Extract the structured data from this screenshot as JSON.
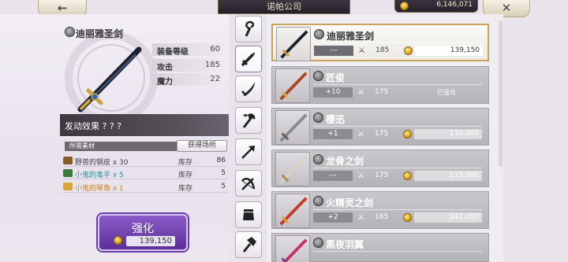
{
  "header": {
    "back_icon": "←",
    "title": "诺帕公司",
    "gold": "6,146,071",
    "close_icon": "✕"
  },
  "detail": {
    "name": "迪丽雅圣剑",
    "stats": [
      {
        "label": "装备等级",
        "value": "60"
      },
      {
        "label": "攻击",
        "value": "185"
      },
      {
        "label": "魔力",
        "value": "22"
      }
    ],
    "effect": "发动效果 ? ? ?",
    "materials_label": "所需素材",
    "source_button": "获得场所",
    "materials": [
      {
        "name": "野兽的钢皮 x 30",
        "stock_label": "库存",
        "stock": "86",
        "color": "#444444",
        "icon_color": "#8b5a2b"
      },
      {
        "name": "小鬼的毒手 x 5",
        "stock_label": "库存",
        "stock": "5",
        "color": "#2f8f9a",
        "icon_color": "#3a7a3a"
      },
      {
        "name": "小鬼的琴角 x 1",
        "stock_label": "库存",
        "stock": "5",
        "color": "#c8862a",
        "icon_color": "#d9a23a"
      }
    ],
    "enhance_label": "强化",
    "enhance_cost": "139,150"
  },
  "tabs": [
    {
      "icon": "staff-icon"
    },
    {
      "icon": "sword-icon"
    },
    {
      "icon": "curved-blade-icon"
    },
    {
      "icon": "axe-icon"
    },
    {
      "icon": "arrow-icon"
    },
    {
      "icon": "crossbow-icon"
    },
    {
      "icon": "gauntlet-icon"
    },
    {
      "icon": "hammer-icon"
    }
  ],
  "items": [
    {
      "name": "迪丽雅圣剑",
      "level": "---",
      "atk": "185",
      "price": "139,150",
      "owned": "",
      "selected": true,
      "blade": "#1c2230",
      "hilt": "#c9a43a"
    },
    {
      "name": "匠俊",
      "level": "+10",
      "atk": "175",
      "price": "",
      "owned": "已强化",
      "selected": false,
      "blade": "#a8452a",
      "hilt": "#d9b45a"
    },
    {
      "name": "樱迅",
      "level": "+1",
      "atk": "175",
      "price": "110,000",
      "owned": "",
      "selected": false,
      "blade": "#8a8a8e",
      "hilt": "#6a5a4a"
    },
    {
      "name": "龙骨之剑",
      "level": "---",
      "atk": "175",
      "price": "115,000",
      "owned": "",
      "selected": false,
      "blade": "#d8d2c4",
      "hilt": "#a88a5a"
    },
    {
      "name": "火精灵之剑",
      "level": "+2",
      "atk": "165",
      "price": "242,000",
      "owned": "",
      "selected": false,
      "blade": "#c23a2a",
      "hilt": "#e0a040"
    },
    {
      "name": "黑夜羽翼",
      "level": "",
      "atk": "",
      "price": "",
      "owned": "",
      "selected": false,
      "blade": "#c2306a",
      "hilt": "#7a3a8a"
    }
  ]
}
